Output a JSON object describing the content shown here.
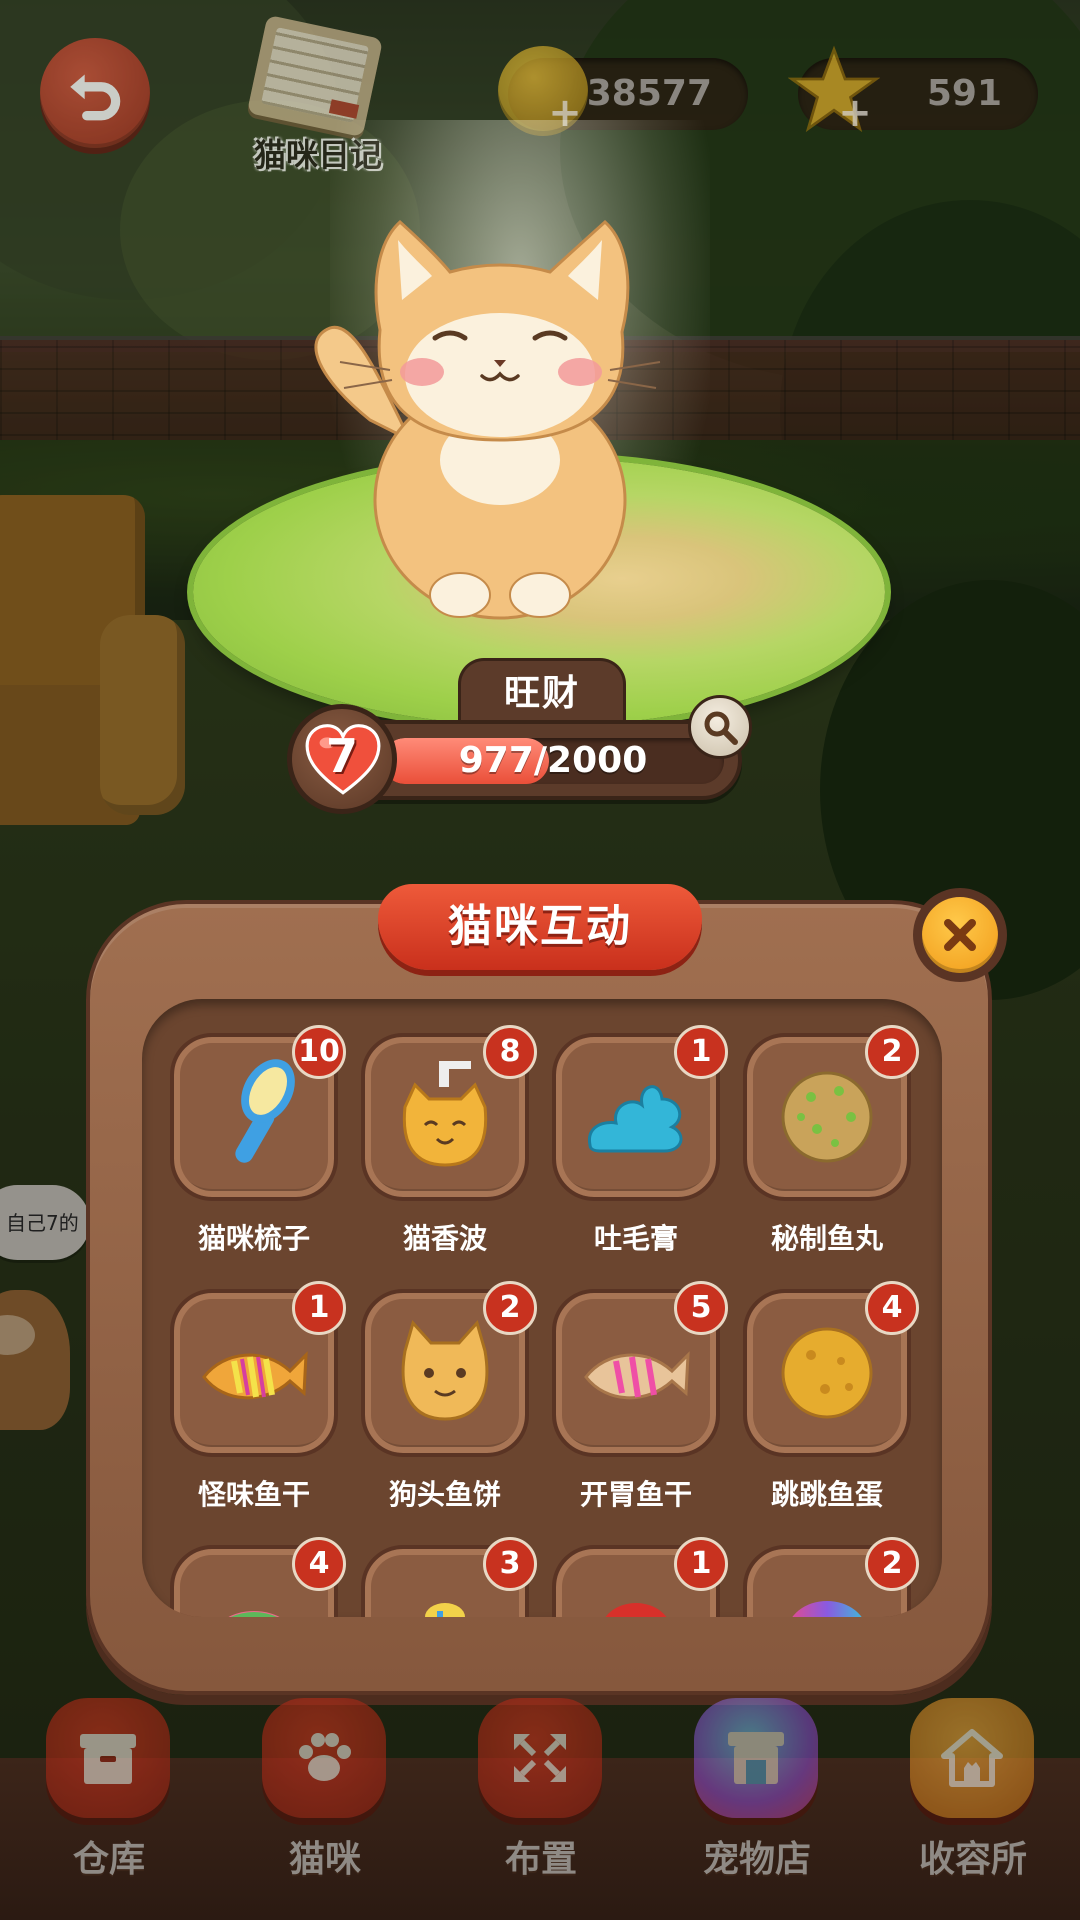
{
  "hud": {
    "diary_label": "猫咪日记",
    "coins": "38577",
    "stars": "591"
  },
  "cat": {
    "name": "旺财",
    "level": "7",
    "exp_text": "977/2000",
    "exp_fraction": 0.4885
  },
  "background_bubble_text": "自己7的",
  "panel": {
    "title": "猫咪互动",
    "items": [
      {
        "label": "猫咪梳子",
        "count": "10",
        "icon": "comb-icon"
      },
      {
        "label": "猫香波",
        "count": "8",
        "icon": "shampoo-icon"
      },
      {
        "label": "吐毛膏",
        "count": "1",
        "icon": "hairball-paste-icon"
      },
      {
        "label": "秘制鱼丸",
        "count": "2",
        "icon": "fish-ball-icon"
      },
      {
        "label": "怪味鱼干",
        "count": "1",
        "icon": "dried-fish-icon"
      },
      {
        "label": "狗头鱼饼",
        "count": "2",
        "icon": "dog-fish-cake-icon"
      },
      {
        "label": "开胃鱼干",
        "count": "5",
        "icon": "appetizer-fish-icon"
      },
      {
        "label": "跳跳鱼蛋",
        "count": "4",
        "icon": "fish-egg-icon"
      },
      {
        "label": "",
        "count": "4",
        "icon": "food-icon"
      },
      {
        "label": "",
        "count": "3",
        "icon": "food-icon"
      },
      {
        "label": "",
        "count": "1",
        "icon": "food-icon"
      },
      {
        "label": "",
        "count": "2",
        "icon": "food-icon"
      }
    ]
  },
  "nav": [
    {
      "label": "仓库",
      "icon": "box-icon"
    },
    {
      "label": "猫咪",
      "icon": "paw-icon"
    },
    {
      "label": "布置",
      "icon": "arrange-icon"
    },
    {
      "label": "宠物店",
      "icon": "shop-icon"
    },
    {
      "label": "收容所",
      "icon": "shelter-icon"
    }
  ],
  "colors": {
    "accent_red": "#c8321f",
    "panel_brown": "#86583d",
    "exp_fill": "#ea4f39",
    "close_yellow": "#f09a18"
  }
}
